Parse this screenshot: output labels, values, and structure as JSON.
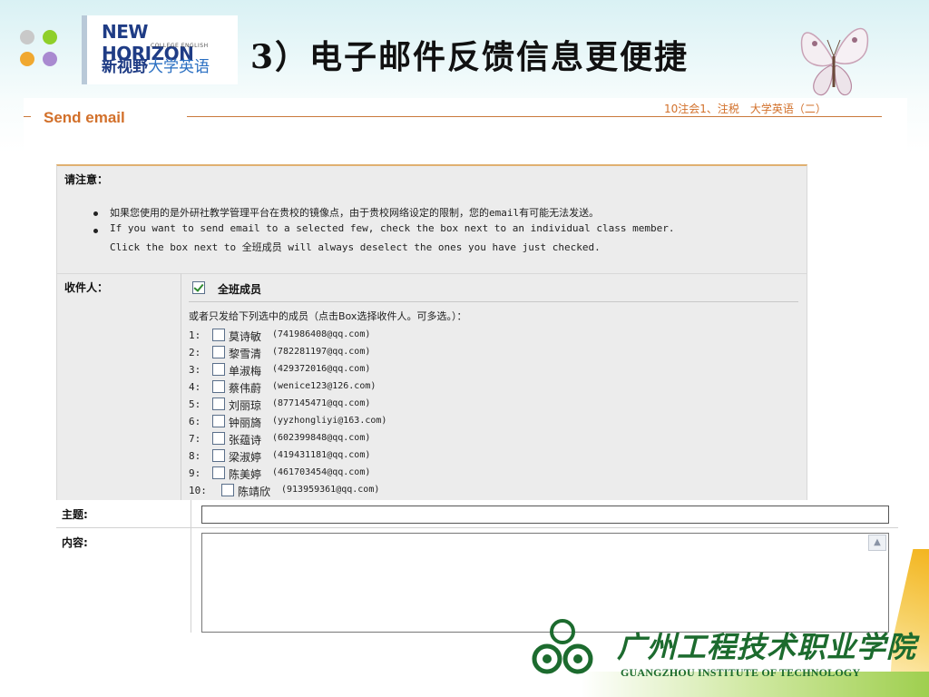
{
  "slide": {
    "title": "3）电子邮件反馈信息更便捷",
    "logo": {
      "en": "NEW HORIZON",
      "sub": "COLLEGE ENGLISH",
      "cn_bold": "新视野",
      "cn_light": "大学英语"
    }
  },
  "email": {
    "header": "Send email",
    "course": "10注会1、注税　大学英语（二）",
    "notice": {
      "heading": "请注意：",
      "lines": [
        "如果您使用的是外研社教学管理平台在贵校的镜像点，由于贵校网络设定的限制，您的email有可能无法发送。",
        "If you want to send email to a selected few, check the box next to an individual class member.",
        "Click the box next to 全班成员 will always deselect the ones you have just checked."
      ]
    },
    "recipients": {
      "label": "收件人：",
      "all_members": "全班成员",
      "all_checked": true,
      "or_text": "或者只发给下列选中的成员（点击Box选择收件人。可多选。）：",
      "members": [
        {
          "num": "1:",
          "name": "莫诗敏",
          "email": "(741986408@qq.com)"
        },
        {
          "num": "2:",
          "name": "黎雪清",
          "email": "(782281197@qq.com)"
        },
        {
          "num": "3:",
          "name": "单淑梅",
          "email": "(429372016@qq.com)"
        },
        {
          "num": "4:",
          "name": "蔡伟蔚",
          "email": "(wenice123@126.com)"
        },
        {
          "num": "5:",
          "name": "刘丽琼",
          "email": "(877145471@qq.com)"
        },
        {
          "num": "6:",
          "name": "钟丽旖",
          "email": "(yyzhongliyi@163.com)"
        },
        {
          "num": "7:",
          "name": "张蕴诗",
          "email": "(602399848@qq.com)"
        },
        {
          "num": "8:",
          "name": "梁淑婷",
          "email": "(419431181@qq.com)"
        },
        {
          "num": "9:",
          "name": "陈美婷",
          "email": "(461703454@qq.com)"
        },
        {
          "num": "10:",
          "name": "陈靖欣",
          "email": "(913959361@qq.com)"
        }
      ]
    },
    "subject": {
      "label": "主题:",
      "value": ""
    },
    "content": {
      "label": "内容:",
      "value": ""
    }
  },
  "institute": {
    "cn": "广州工程技术职业学院",
    "en": "GUANGZHOU INSTITUTE OF TECHNOLOGY"
  },
  "colors": {
    "accent": "#d2702a",
    "panel": "#ececec",
    "institute": "#1c6b2e"
  }
}
